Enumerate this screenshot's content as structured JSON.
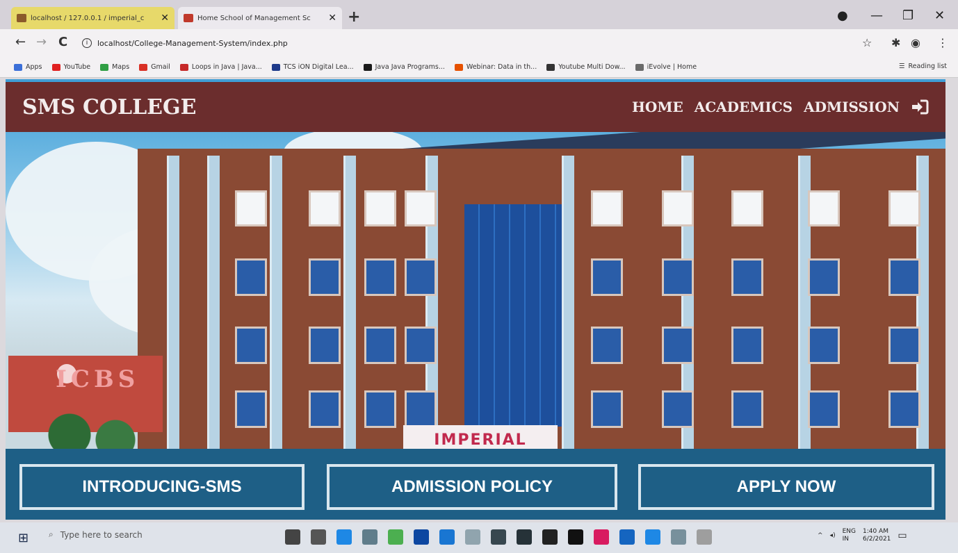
{
  "browser": {
    "tabs": [
      {
        "title": "localhost / 127.0.0.1 / imperial_c",
        "close": "✕"
      },
      {
        "title": "Home School of Management Sc",
        "close": "✕"
      }
    ],
    "new_tab": "+",
    "window_controls": {
      "minimize": "—",
      "maximize": "❐",
      "close": "✕"
    },
    "nav": {
      "back": "←",
      "forward": "→",
      "reload": "C"
    },
    "url": "localhost/College-Management-System/index.php",
    "bookmarks": [
      {
        "label": "Apps",
        "color": "#3b6fd8"
      },
      {
        "label": "YouTube",
        "color": "#e02020"
      },
      {
        "label": "Maps",
        "color": "#2f9e44"
      },
      {
        "label": "Gmail",
        "color": "#d93025"
      },
      {
        "label": "Loops in Java | Java...",
        "color": "#c62828"
      },
      {
        "label": "TCS iON Digital Lea...",
        "color": "#1e3a8a"
      },
      {
        "label": "Java Java Programs...",
        "color": "#1a1a1a"
      },
      {
        "label": "Webinar: Data in th...",
        "color": "#e65100"
      },
      {
        "label": "Youtube Multi Dow...",
        "color": "#333333"
      },
      {
        "label": "iEvolve | Home",
        "color": "#6a6a6a"
      }
    ],
    "reading_list": "Reading list"
  },
  "site": {
    "brand": "SMS COLLEGE",
    "nav": [
      "HOME",
      "ACADEMICS",
      "ADMISSION"
    ],
    "login_icon": "sign-in-icon",
    "hero_sign": "IMPERIAL",
    "hero_logo": "ICBS",
    "cta": [
      "INTRODUCING-SMS",
      "ADMISSION POLICY",
      "APPLY NOW"
    ],
    "colors": {
      "navbar": "#6b2d2d",
      "band": "#1e5f86"
    }
  },
  "taskbar": {
    "search_placeholder": "Type here to search",
    "tray": {
      "lang": "ENG",
      "region": "IN",
      "time": "1:40 AM",
      "date": "6/2/2021"
    }
  }
}
